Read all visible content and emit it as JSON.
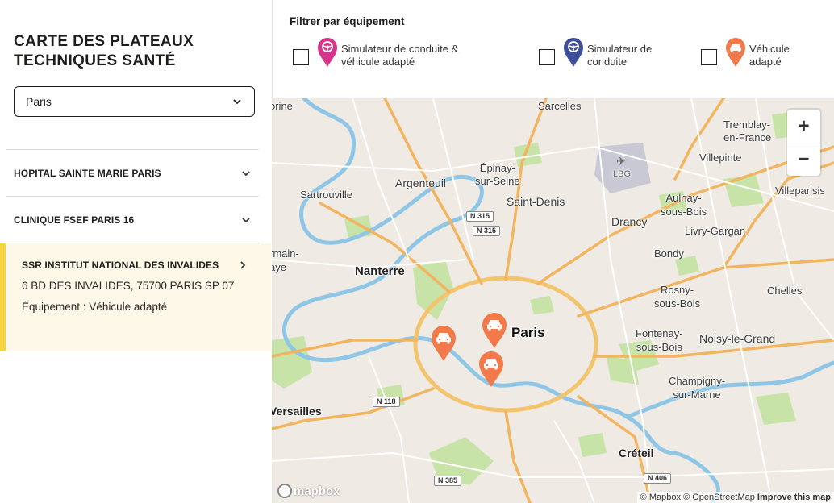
{
  "sidebar": {
    "title": "CARTE DES PLATEAUX TECHNIQUES SANTÉ",
    "select_value": "Paris",
    "items": [
      {
        "name": "HOPITAL SAINTE MARIE PARIS"
      },
      {
        "name": "CLINIQUE FSEF PARIS 16"
      },
      {
        "name": "SSR INSTITUT NATIONAL DES INVALIDES",
        "address": "6 BD DES INVALIDES, 75700 PARIS SP 07",
        "equipment": "Équipement : Véhicule adapté"
      }
    ]
  },
  "filters": {
    "title": "Filtrer par équipement",
    "options": [
      {
        "label": "Simulateur de conduite & véhicule adapté",
        "color": "#d6338a",
        "icon": "steering-wheel-car-icon",
        "checked": false
      },
      {
        "label": "Simulateur de conduite",
        "color": "#3d4f9c",
        "icon": "steering-wheel-icon",
        "checked": false
      },
      {
        "label": "Véhicule adapté",
        "color": "#f27a4a",
        "icon": "car-icon",
        "checked": false
      }
    ]
  },
  "map": {
    "labels": {
      "sartrouville": "Sartrouville",
      "argenteuil": "Argenteuil",
      "epinay": "Épinay-\nsur-Seine",
      "sarcelles": "Sarcelles",
      "tremblay": "Tremblay-\nen-France",
      "villepinte": "Villepinte",
      "villeparisis": "Villeparisis",
      "saint_denis": "Saint-Denis",
      "drancy": "Drancy",
      "aulnay": "Aulnay-\nsous-Bois",
      "livry": "Livry-Gargan",
      "bondy": "Bondy",
      "nanterre": "Nanterre",
      "rosny": "Rosny-\nsous-Bois",
      "chelles": "Chelles",
      "paris": "Paris",
      "fontenay": "Fontenay-\nsous-Bois",
      "noisy": "Noisy-le-Grand",
      "champigny": "Champigny-\nsur-Marne",
      "versailles": "Versailles",
      "creteil": "Créteil",
      "germain": "rmain-\naye",
      "orine": "orine",
      "lbg": "LBG"
    },
    "roads": {
      "n315a": "N 315",
      "n315b": "N 315",
      "n118": "N 118",
      "n385": "N 385",
      "n406": "N 406"
    },
    "markers": [
      {
        "name": "Véhicule adapté",
        "color": "#f27a4a"
      },
      {
        "name": "Véhicule adapté",
        "color": "#f27a4a"
      },
      {
        "name": "Véhicule adapté",
        "color": "#f27a4a"
      }
    ],
    "zoom_in": "+",
    "zoom_out": "−",
    "logo": "mapbox",
    "attribution": {
      "mapbox": "© Mapbox",
      "osm": "© OpenStreetMap",
      "improve": "Improve this map"
    }
  }
}
